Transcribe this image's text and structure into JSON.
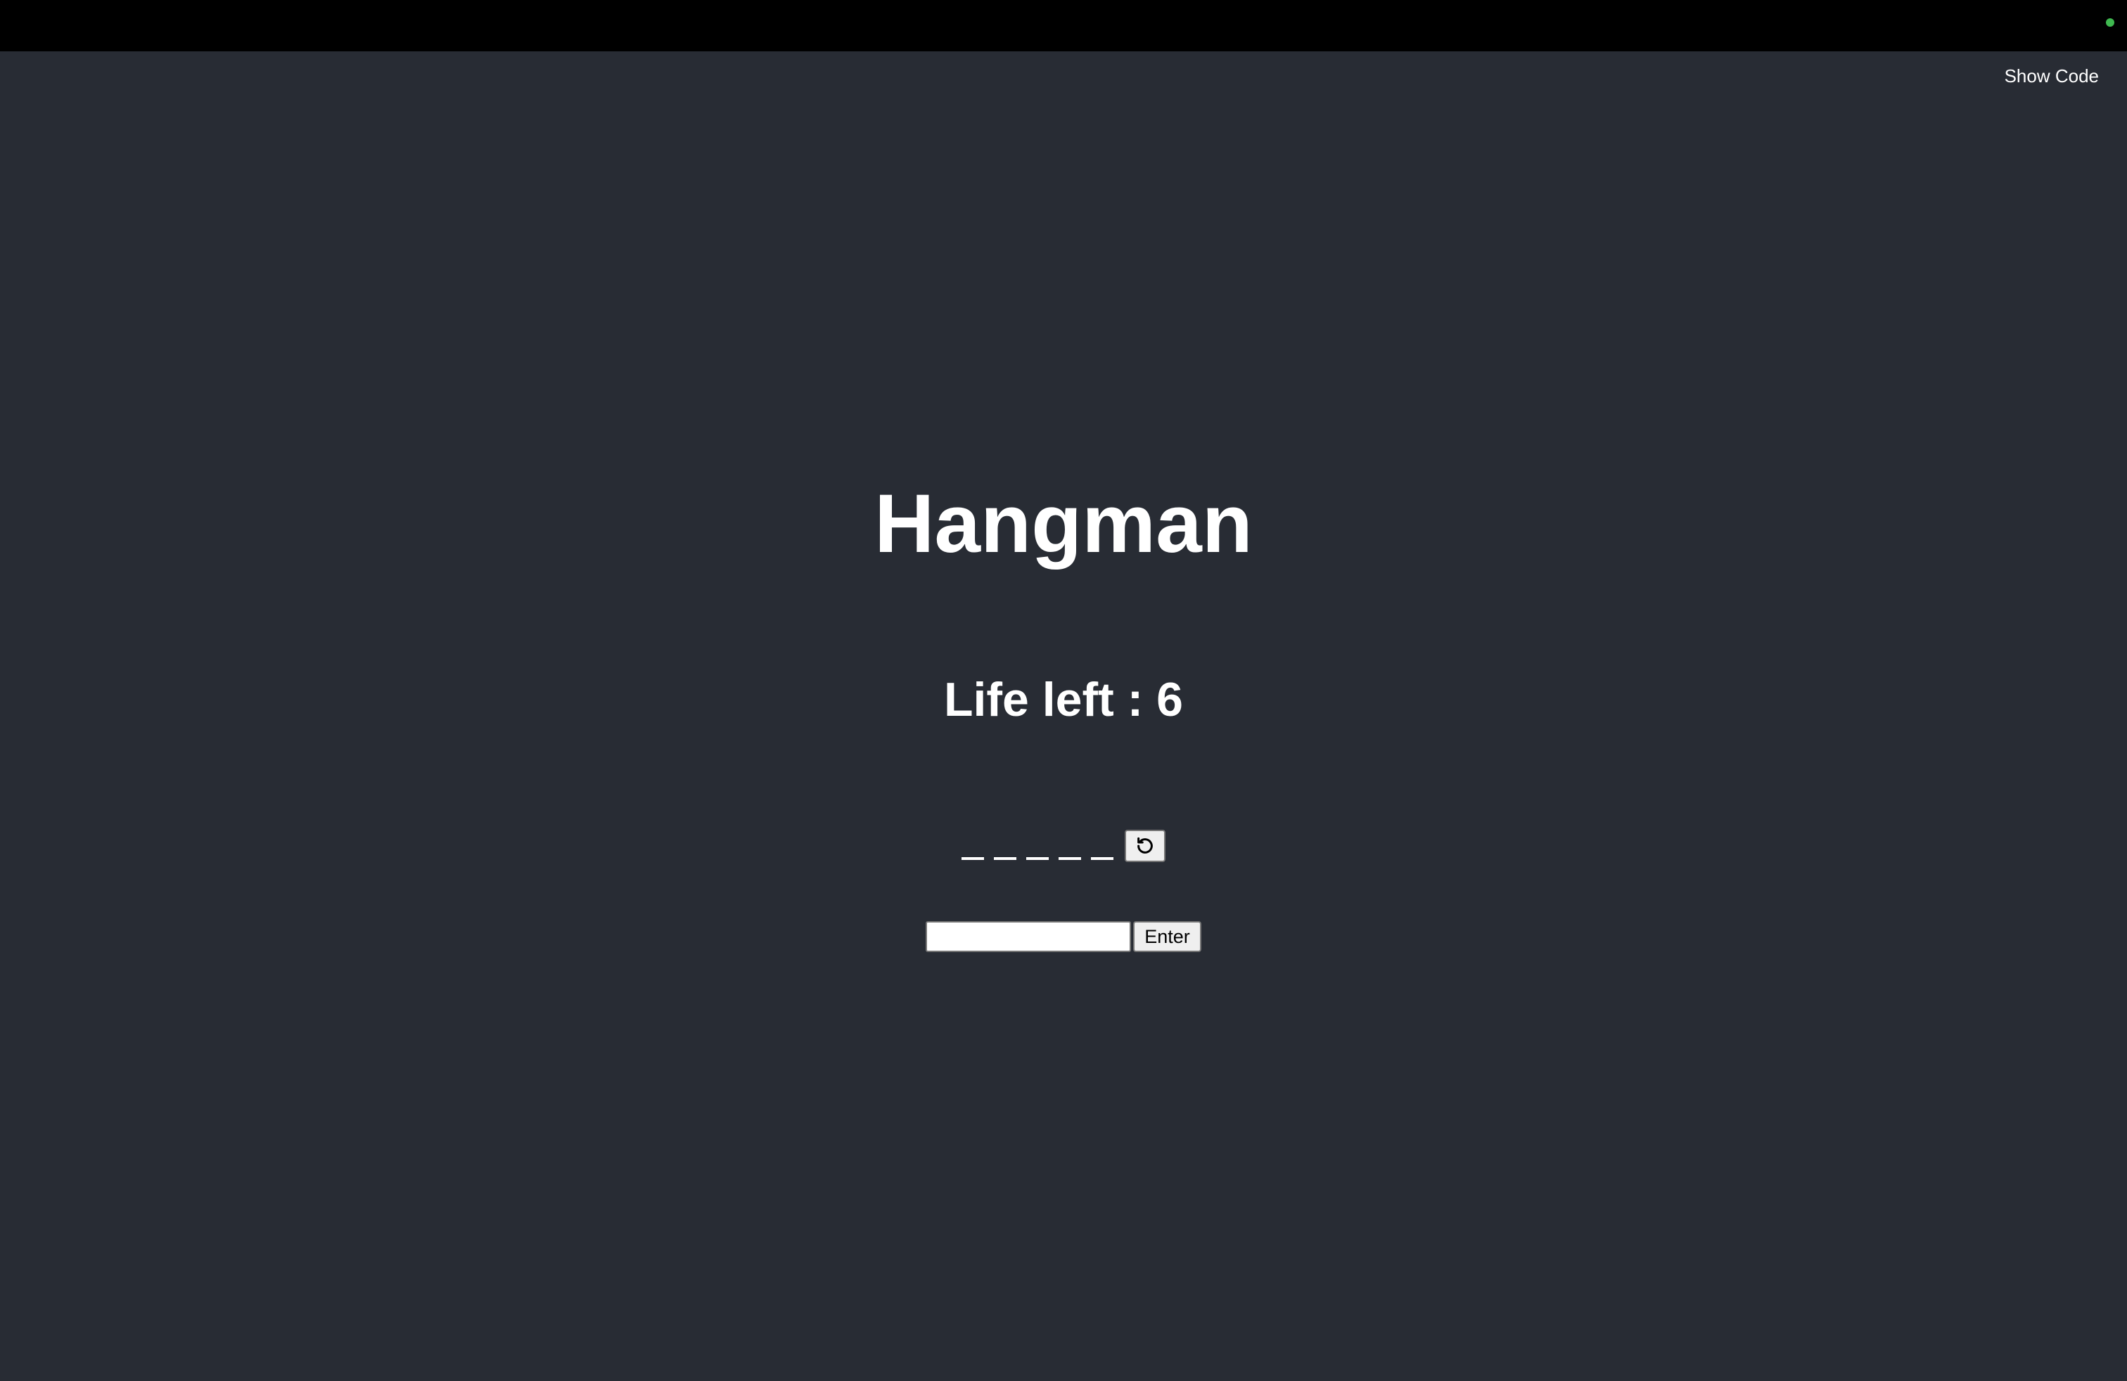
{
  "app": {
    "show_code_label": "Show Code",
    "status_color": "#3fb950",
    "background_color": "#282c34",
    "topbar_color": "#000000"
  },
  "game": {
    "title": "Hangman",
    "lives_text": "Life left : 6",
    "lives_remaining": 6,
    "word_blanks": [
      "_",
      "_",
      "_",
      "_",
      "_"
    ],
    "reset_icon": "reset-icon",
    "guess_input_value": "",
    "guess_input_placeholder": "",
    "enter_label": "Enter"
  }
}
